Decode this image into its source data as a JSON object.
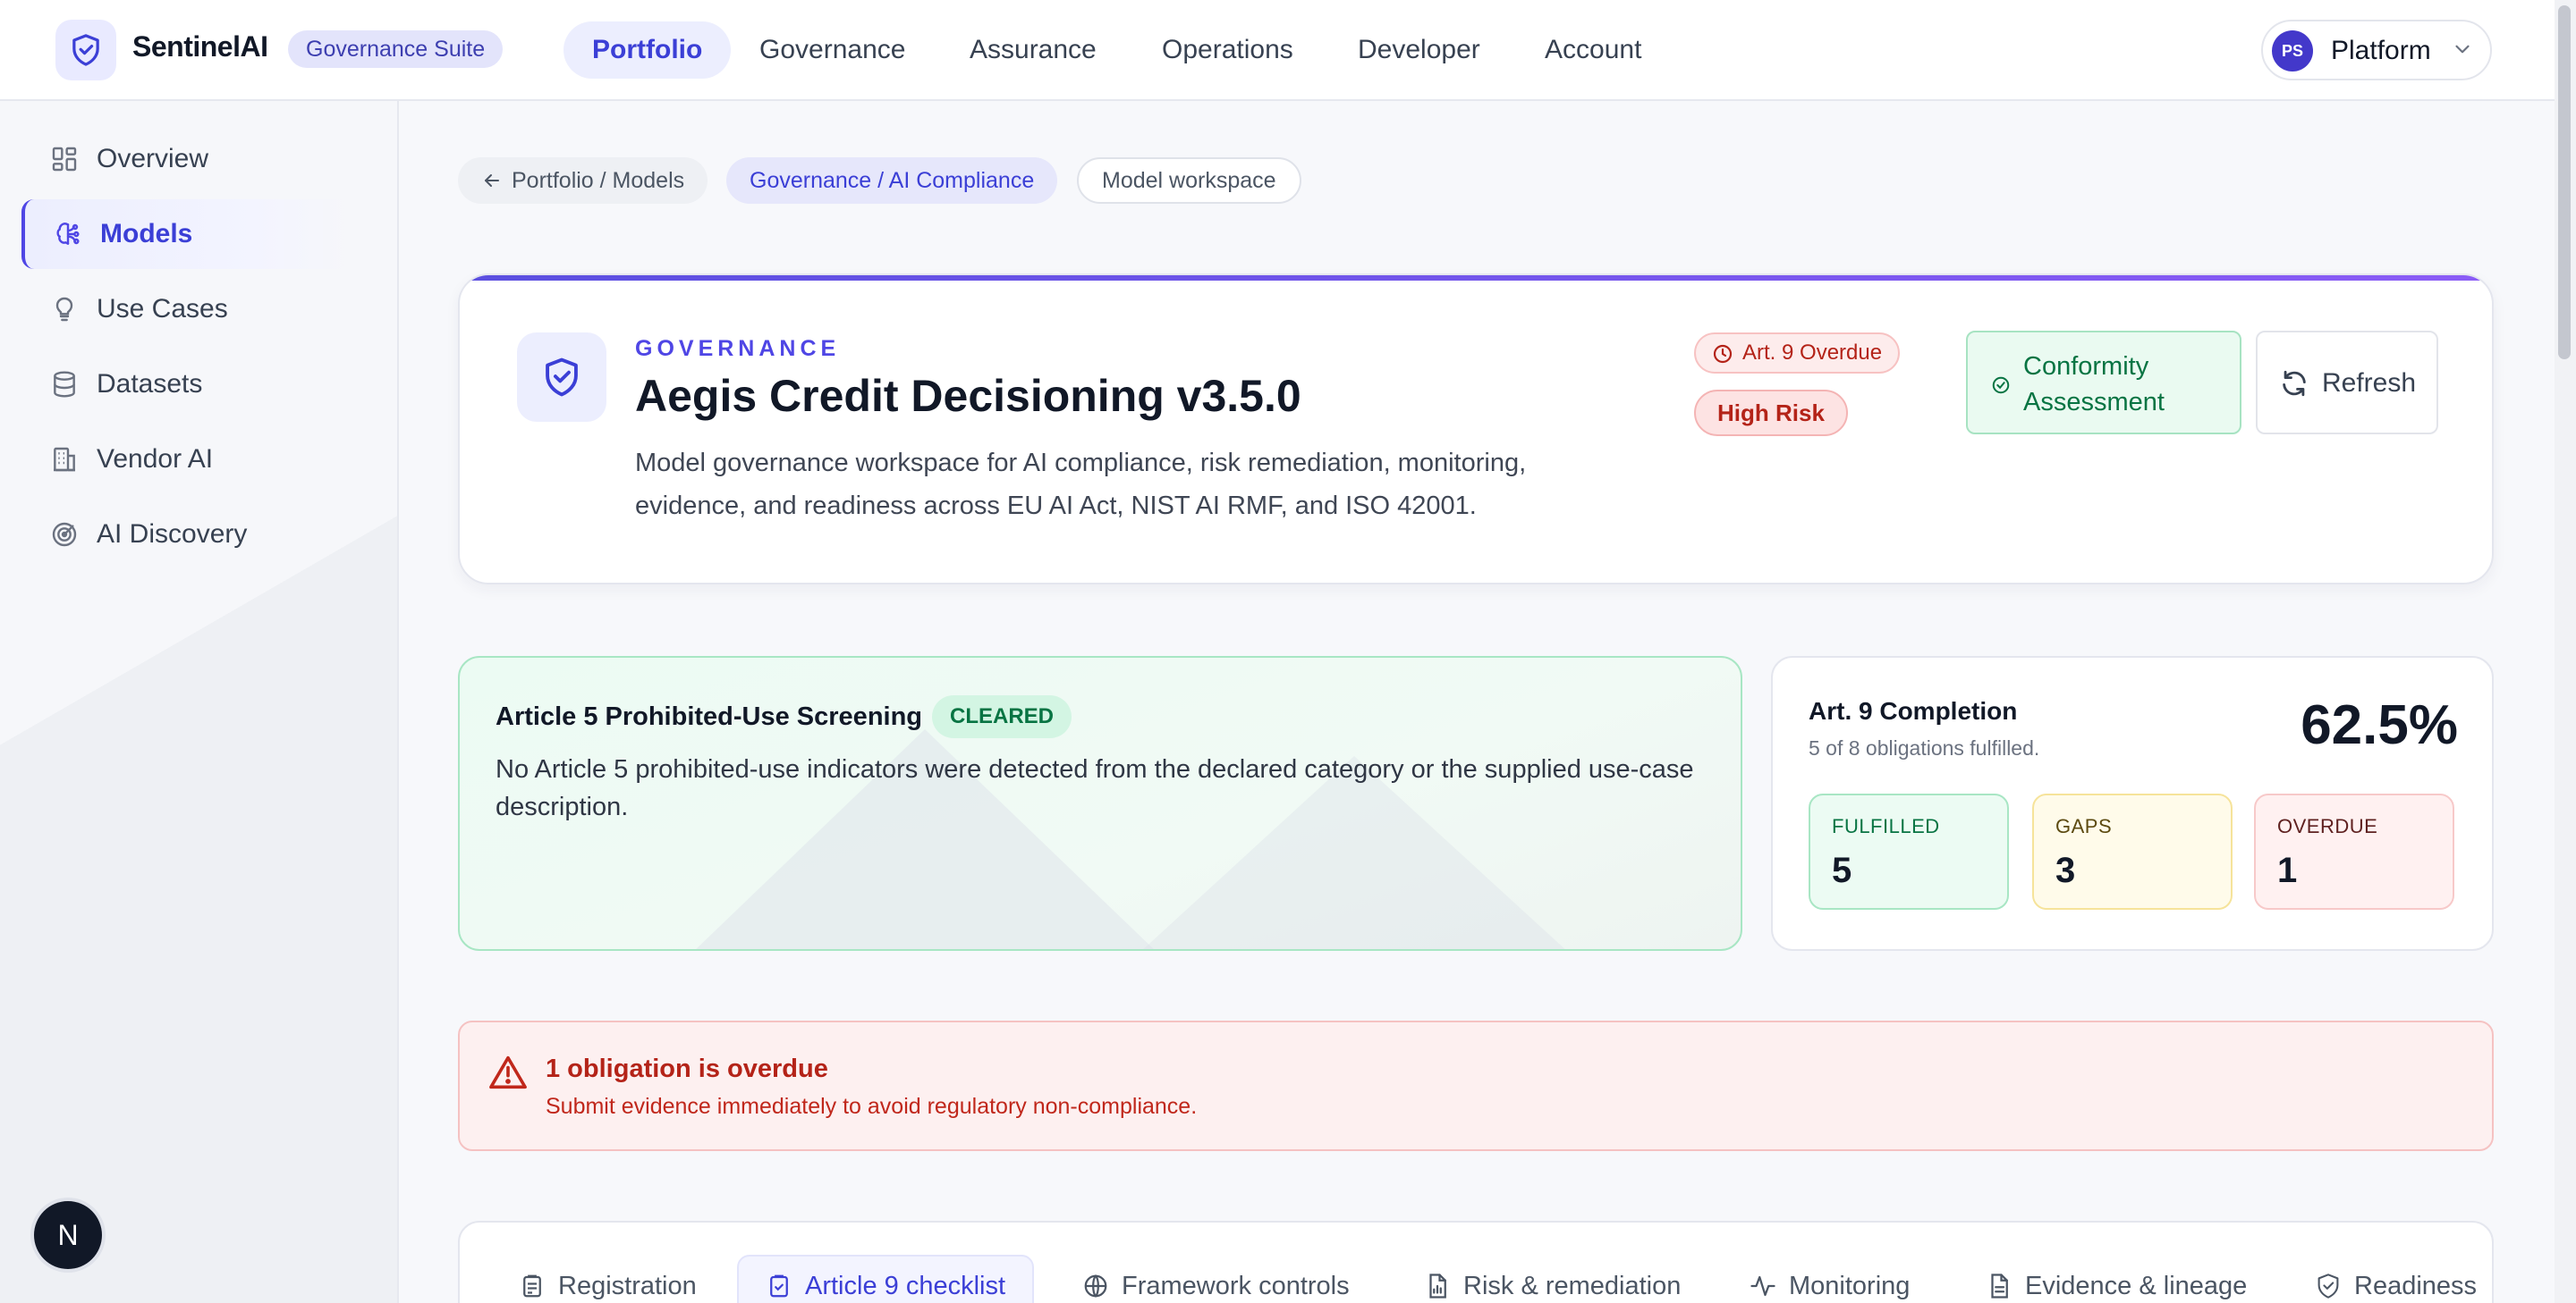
{
  "brand": {
    "name": "SentinelAI",
    "suite": "Governance Suite"
  },
  "topnav": {
    "items": [
      {
        "label": "Portfolio",
        "active": true
      },
      {
        "label": "Governance"
      },
      {
        "label": "Assurance"
      },
      {
        "label": "Operations"
      },
      {
        "label": "Developer"
      },
      {
        "label": "Account"
      }
    ],
    "platform": {
      "initials": "PS",
      "label": "Platform"
    }
  },
  "sidebar": {
    "items": [
      {
        "label": "Overview",
        "icon": "grid-icon"
      },
      {
        "label": "Models",
        "icon": "brain-icon",
        "active": true
      },
      {
        "label": "Use Cases",
        "icon": "lightbulb-icon"
      },
      {
        "label": "Datasets",
        "icon": "database-icon"
      },
      {
        "label": "Vendor AI",
        "icon": "building-icon"
      },
      {
        "label": "AI Discovery",
        "icon": "radar-icon"
      }
    ],
    "badge": "N"
  },
  "breadcrumbs": {
    "back": "Portfolio / Models",
    "section": "Governance / AI Compliance",
    "current": "Model workspace"
  },
  "header": {
    "eyebrow": "GOVERNANCE",
    "title": "Aegis Credit Decisioning v3.5.0",
    "description": "Model governance workspace for AI compliance, risk remediation, monitoring, evidence, and readiness across EU AI Act, NIST AI RMF, and ISO 42001.",
    "overdue_pill": "Art. 9 Overdue",
    "risk_pill": "High Risk",
    "conformity_button": "Conformity Assessment",
    "refresh_button": "Refresh"
  },
  "article5": {
    "title": "Article 5 Prohibited-Use Screening",
    "status": "CLEARED",
    "text": "No Article 5 prohibited-use indicators were detected from the declared category or the supplied use-case description."
  },
  "completion": {
    "title": "Art. 9 Completion",
    "subtitle": "5 of 8 obligations fulfilled.",
    "percent": "62.5%",
    "fulfilled_label": "FULFILLED",
    "fulfilled_value": "5",
    "gaps_label": "GAPS",
    "gaps_value": "3",
    "overdue_label": "OVERDUE",
    "overdue_value": "1"
  },
  "alert": {
    "title": "1 obligation is overdue",
    "subtitle": "Submit evidence immediately to avoid regulatory non-compliance."
  },
  "tabs": [
    {
      "label": "Registration"
    },
    {
      "label": "Article 9 checklist",
      "active": true
    },
    {
      "label": "Framework controls"
    },
    {
      "label": "Risk & remediation"
    },
    {
      "label": "Monitoring"
    },
    {
      "label": "Evidence & lineage"
    },
    {
      "label": "Readiness"
    }
  ],
  "colors": {
    "accent": "#4f46e5",
    "success": "#087443",
    "danger": "#b42318"
  }
}
